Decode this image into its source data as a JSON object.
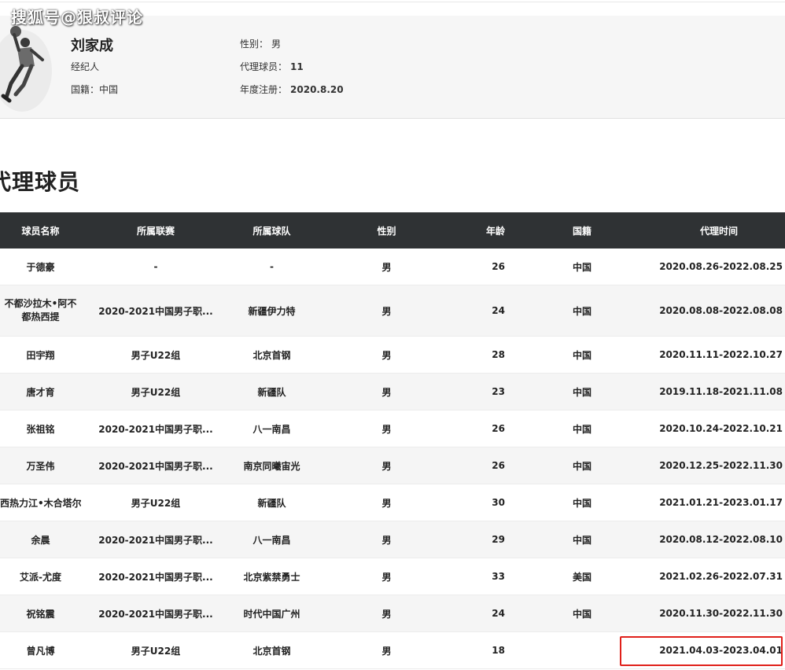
{
  "watermark": "搜狐号@狠叔评论",
  "profile": {
    "name": "刘家成",
    "role": "经纪人",
    "nationality": "国籍：中国",
    "gender_label": "性别：",
    "gender_value": "男",
    "players_label": "代理球员：",
    "players_value": "11",
    "registration_label": "年度注册：",
    "registration_value": "2020.8.20"
  },
  "section_title": "代理球员",
  "table": {
    "headers": [
      "球员名称",
      "所属联赛",
      "所属球队",
      "性别",
      "年龄",
      "国籍",
      "代理时间"
    ],
    "rows": [
      {
        "name": "于德豪",
        "league": "-",
        "team": "-",
        "gender": "男",
        "age": "26",
        "nation": "中国",
        "period": "2020.08.26-2022.08.25"
      },
      {
        "name": "不都沙拉木•阿不都热西提",
        "league": "2020-2021中国男子职...",
        "team": "新疆伊力特",
        "gender": "男",
        "age": "24",
        "nation": "中国",
        "period": "2020.08.08-2022.08.08"
      },
      {
        "name": "田宇翔",
        "league": "男子U22组",
        "team": "北京首钢",
        "gender": "男",
        "age": "28",
        "nation": "中国",
        "period": "2020.11.11-2022.10.27"
      },
      {
        "name": "唐才育",
        "league": "男子U22组",
        "team": "新疆队",
        "gender": "男",
        "age": "23",
        "nation": "中国",
        "period": "2019.11.18-2021.11.08"
      },
      {
        "name": "张祖铭",
        "league": "2020-2021中国男子职...",
        "team": "八一南昌",
        "gender": "男",
        "age": "26",
        "nation": "中国",
        "period": "2020.10.24-2022.10.21"
      },
      {
        "name": "万圣伟",
        "league": "2020-2021中国男子职...",
        "team": "南京同曦宙光",
        "gender": "男",
        "age": "26",
        "nation": "中国",
        "period": "2020.12.25-2022.11.30"
      },
      {
        "name": "西热力江•木合塔尔",
        "league": "男子U22组",
        "team": "新疆队",
        "gender": "男",
        "age": "30",
        "nation": "中国",
        "period": "2021.01.21-2023.01.17"
      },
      {
        "name": "余晨",
        "league": "2020-2021中国男子职...",
        "team": "八一南昌",
        "gender": "男",
        "age": "29",
        "nation": "中国",
        "period": "2020.08.12-2022.08.10"
      },
      {
        "name": "艾派-尤度",
        "league": "2020-2021中国男子职...",
        "team": "北京紫禁勇士",
        "gender": "男",
        "age": "33",
        "nation": "美国",
        "period": "2021.02.26-2022.07.31"
      },
      {
        "name": "祝铭震",
        "league": "2020-2021中国男子职...",
        "team": "时代中国广州",
        "gender": "男",
        "age": "24",
        "nation": "中国",
        "period": "2020.11.30-2022.11.30"
      },
      {
        "name": "曾凡博",
        "league": "男子U22组",
        "team": "北京首钢",
        "gender": "男",
        "age": "18",
        "nation": "",
        "period": "2021.04.03-2023.04.01"
      }
    ]
  },
  "colors": {
    "header_bg": "#2f3234",
    "highlight": "#e0201a",
    "profile_bg": "#f6f6f6"
  }
}
